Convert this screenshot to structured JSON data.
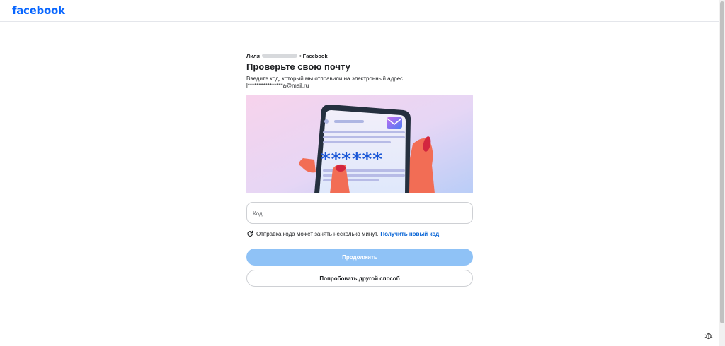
{
  "header": {
    "logo": "facebook"
  },
  "breadcrumb": {
    "name": "Лиля",
    "separator": "•",
    "site": "Facebook"
  },
  "page": {
    "title": "Проверьте свою почту",
    "description": "Введите код, который мы отправили на электронный адрес",
    "email": "l****************a@mail.ru"
  },
  "illustration": {
    "password_mask": "******"
  },
  "code_input": {
    "placeholder": "Код",
    "value": ""
  },
  "resend": {
    "text": "Отправка кода может занять несколько минут.",
    "link": "Получить новый код"
  },
  "buttons": {
    "continue": "Продолжить",
    "other_method": "Попробовать другой способ"
  },
  "colors": {
    "brand": "#0866ff",
    "primary_disabled": "#8fc2f6",
    "link": "#0a66d6"
  }
}
